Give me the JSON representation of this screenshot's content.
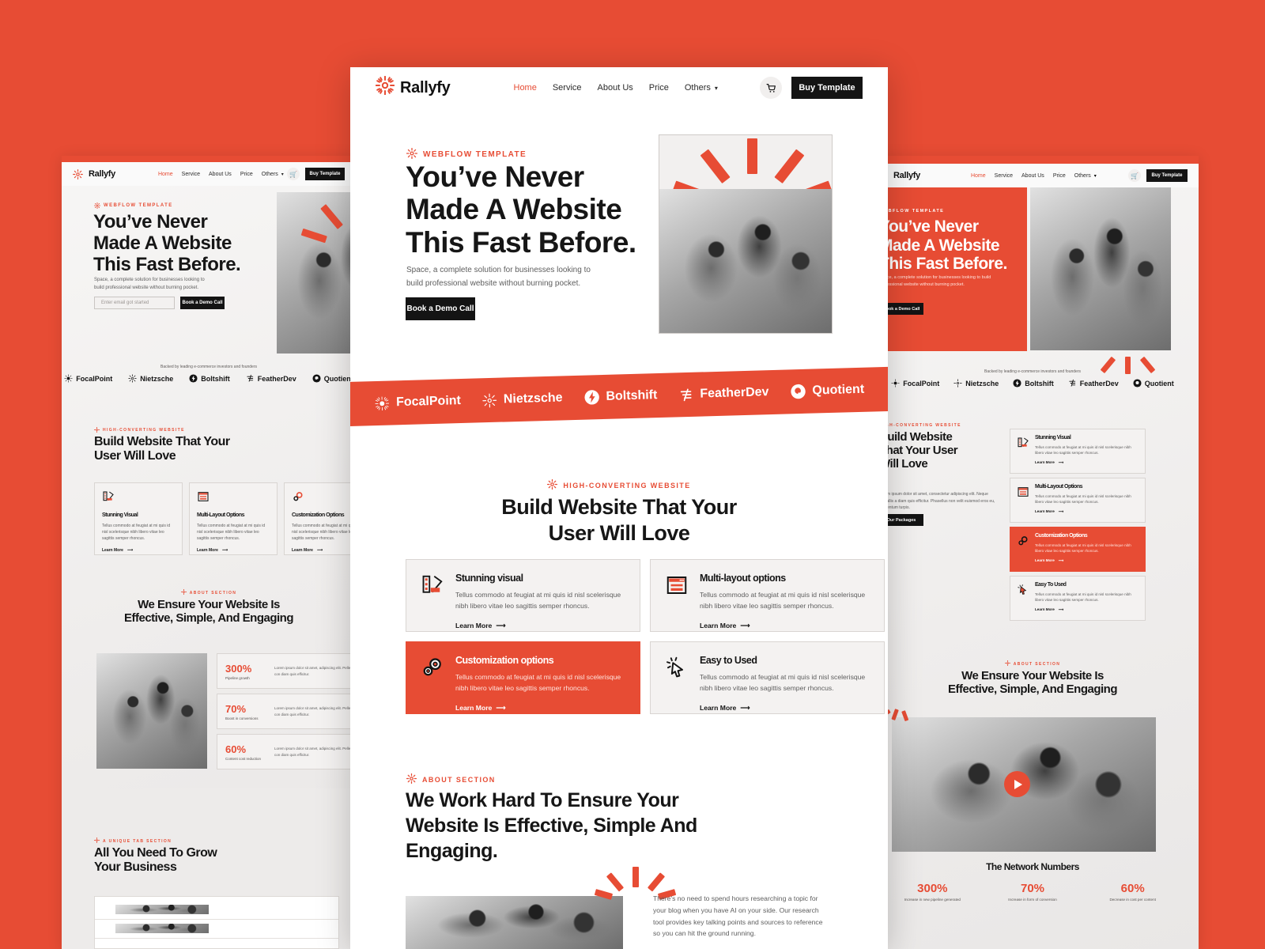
{
  "theme": {
    "red": "#e74c34",
    "dark": "#141414",
    "card_bg": "#f4f2f1",
    "page_bg": "#ffffff"
  },
  "brand": {
    "name": "Rallyfy",
    "logo_icon": "sunburst-icon"
  },
  "nav": {
    "items": [
      {
        "label": "Home",
        "active": true
      },
      {
        "label": "Service",
        "active": false
      },
      {
        "label": "About Us",
        "active": false
      },
      {
        "label": "Price",
        "active": false
      },
      {
        "label": "Others",
        "active": false,
        "caret": true
      }
    ],
    "cart_icon": "cart-icon",
    "cta_label": "Buy Template"
  },
  "hero": {
    "eyebrow": "WEBFLOW TEMPLATE",
    "eyebrow_icon": "sunburst-icon",
    "title_lines": [
      "You’ve Never",
      "Made A Website",
      "This Fast Before."
    ],
    "paragraph": "Space, a complete solution for businesses looking to build professional website without burning pocket.",
    "cta_label": "Book a Demo Call",
    "email_placeholder": "Enter email got started",
    "image_alt": "team-collaborating-photo"
  },
  "logo_band": {
    "caption": "Backed by leading e-commerce investors and founders",
    "logos": [
      {
        "name": "FocalPoint",
        "icon": "radial-burst-icon"
      },
      {
        "name": "Nietzsche",
        "icon": "star-burst-icon"
      },
      {
        "name": "Boltshift",
        "icon": "bolt-circle-icon"
      },
      {
        "name": "FeatherDev",
        "icon": "feather-lines-icon"
      },
      {
        "name": "Quotient",
        "icon": "q-circle-icon"
      }
    ]
  },
  "features": {
    "eyebrow": "HIGH-CONVERTING WEBSITE",
    "eyebrow_icon": "sunburst-icon",
    "title_lines": [
      "Build Website That Your",
      "User Will Love"
    ],
    "title_lines_alt": [
      "Build Website",
      "That Your User",
      "Will Love"
    ],
    "alt_paragraph": "Lorem ipsum dolor sit amet, consectetur adipiscing elit. Neque corvallis a diam quis efficitur. Phasellus non velit euismod eros eu, fermentum turpis.",
    "alt_cta_label": "Our Packages",
    "learn_more_label": "Learn More",
    "body_text": "Tellus commodo at feugiat at mi quis id nisl scelerisque nibh libero vitae leo sagittis semper rhoncus.",
    "cards": [
      {
        "title": "Stunning visual",
        "title_alt": "Stunning Visual",
        "icon": "image-stack-icon",
        "highlight": false
      },
      {
        "title": "Multi-layout options",
        "title_alt": "Multi-Layout Options",
        "icon": "browser-window-icon",
        "highlight": false
      },
      {
        "title": "Customization options",
        "title_alt": "Customization Options",
        "icon": "gears-icon",
        "highlight": true
      },
      {
        "title": "Easy to Used",
        "title_alt": "Easy To Used",
        "icon": "cursor-click-icon",
        "highlight": false
      }
    ]
  },
  "about": {
    "eyebrow": "ABOUT SECTION",
    "eyebrow_icon": "sunburst-icon",
    "title_lines": [
      "We Work Hard To Ensure Your",
      "Website Is Effective, Simple And",
      "Engaging."
    ],
    "title_lines_alt": [
      "We Ensure Your Website Is",
      "Effective, Simple, And Engaging"
    ],
    "paragraph": "There's no need to spend hours researching a topic for your blog when you have AI on your side. Our research tool provides key talking points and sources to reference so you can hit the ground running.",
    "image_alt": "office-meeting-photo",
    "play_icon": "play-icon"
  },
  "stats": {
    "heading": "The Network Numbers",
    "items": [
      {
        "value": "300%",
        "label": "Pipeline growth",
        "label_alt": "Increase in new pipeline generated",
        "body": "Lorem ipsum dolor sit amet, adipiscing elit. Pellentesque con diam quis efficitur."
      },
      {
        "value": "70%",
        "label": "Boost in conversions",
        "label_alt": "Increase in form of conversion",
        "body": "Lorem ipsum dolor sit amet, adipiscing elit. Pellentesque con diam quis efficitur."
      },
      {
        "value": "60%",
        "label": "Content cost reduction",
        "label_alt": "Decrease in cost per content",
        "body": "Lorem ipsum dolor sit amet, adipiscing elit. Pellentesque con diam quis efficitur."
      }
    ]
  },
  "tab_section": {
    "eyebrow": "A UNIQUE TAB SECTION",
    "eyebrow_icon": "sunburst-icon",
    "title_lines": [
      "All You Need To Grow",
      "Your Business"
    ]
  }
}
